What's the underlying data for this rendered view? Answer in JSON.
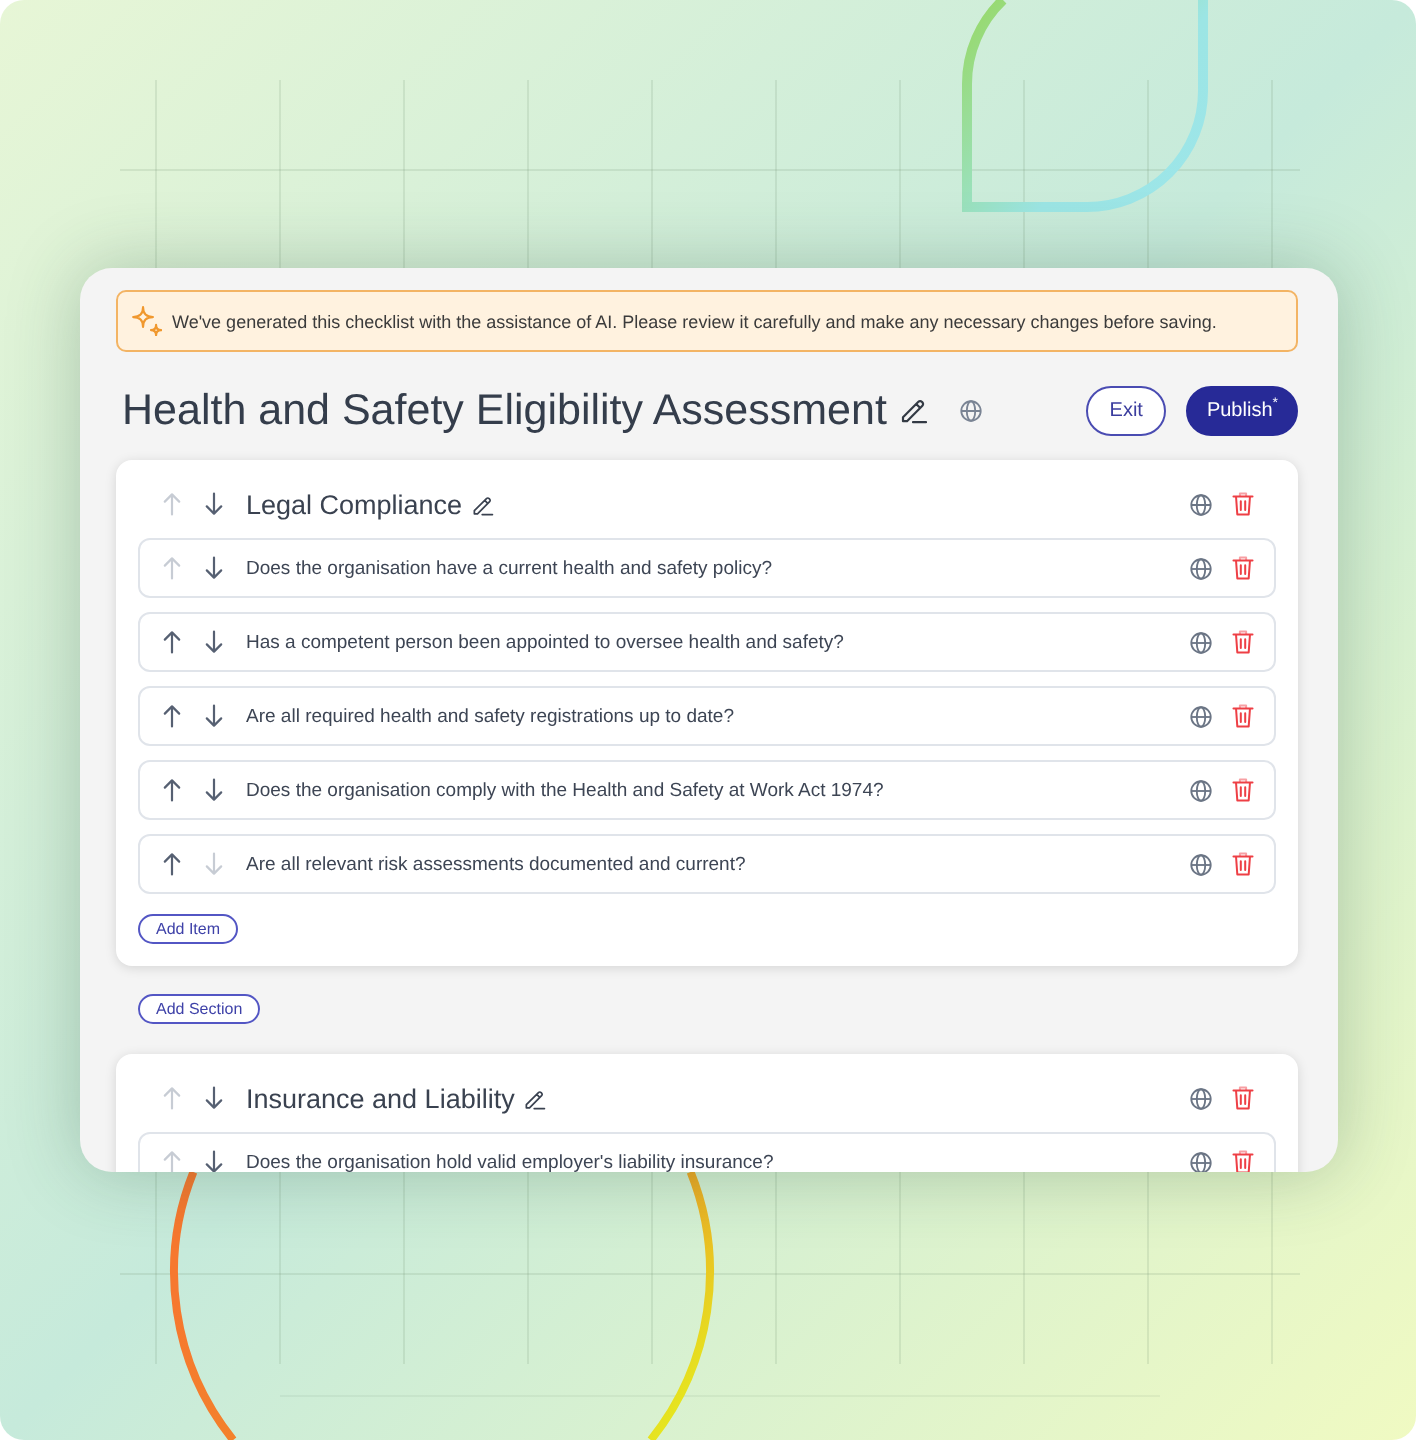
{
  "notice": {
    "text": "We've generated this checklist with the assistance of AI. Please review it carefully and make any necessary changes before saving."
  },
  "header": {
    "title": "Health and Safety Eligibility Assessment",
    "buttons": [
      {
        "label": "Exit",
        "kind": "secondary"
      },
      {
        "label": "Publish$^{*}$",
        "kind": "primary"
      }
    ]
  },
  "blocks": [
    {
      "kind": "section",
      "title": "Legal Compliance",
      "up_disabled": true,
      "down_disabled": false,
      "items": [
        {
          "text": "Does the organisation have a current health and safety policy?",
          "up_disabled": true,
          "down_disabled": false
        },
        {
          "text": "Has a competent person been appointed to oversee health and safety?",
          "up_disabled": false,
          "down_disabled": false
        },
        {
          "text": "Are all required health and safety registrations up to date?",
          "up_disabled": false,
          "down_disabled": false
        },
        {
          "text": "Does the organisation comply with the Health and Safety at Work Act 1974?",
          "up_disabled": false,
          "down_disabled": false
        },
        {
          "text": "Are all relevant risk assessments documented and current?",
          "up_disabled": false,
          "down_disabled": true
        }
      ],
      "add_item_label": "Add Item"
    },
    {
      "kind": "add_section",
      "label": "Add Section"
    },
    {
      "kind": "section",
      "title": "Insurance and Liability",
      "up_disabled": true,
      "down_disabled": false,
      "items": [
        {
          "text": "Does the organisation hold valid employer's liability insurance?",
          "up_disabled": true,
          "down_disabled": false
        }
      ]
    }
  ]
}
